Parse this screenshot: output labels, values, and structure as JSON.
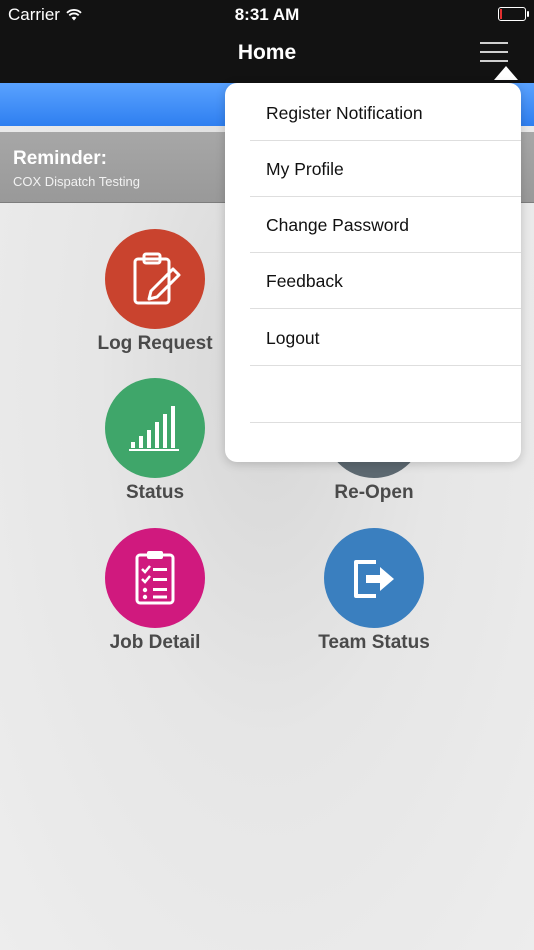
{
  "status_bar": {
    "carrier": "Carrier",
    "time": "8:31 AM"
  },
  "nav": {
    "title": "Home"
  },
  "reminder": {
    "title": "Reminder:",
    "text": "COX Dispatch Testing"
  },
  "tiles": [
    {
      "label": "Log Request",
      "color": "#c9432e",
      "icon": "clipboard-pencil-icon"
    },
    {
      "label": "Status",
      "color": "#3fa66a",
      "icon": "bar-chart-icon"
    },
    {
      "label": "Re-Open",
      "color": "#5c6870",
      "icon": "reopen-icon"
    },
    {
      "label": "Job Detail",
      "color": "#d0197e",
      "icon": "checklist-icon"
    },
    {
      "label": "Team Status",
      "color": "#3a7fbf",
      "icon": "exit-arrow-icon"
    }
  ],
  "menu": {
    "items": [
      "Register Notification",
      "My Profile",
      "Change Password",
      "Feedback",
      "Logout",
      ""
    ]
  }
}
